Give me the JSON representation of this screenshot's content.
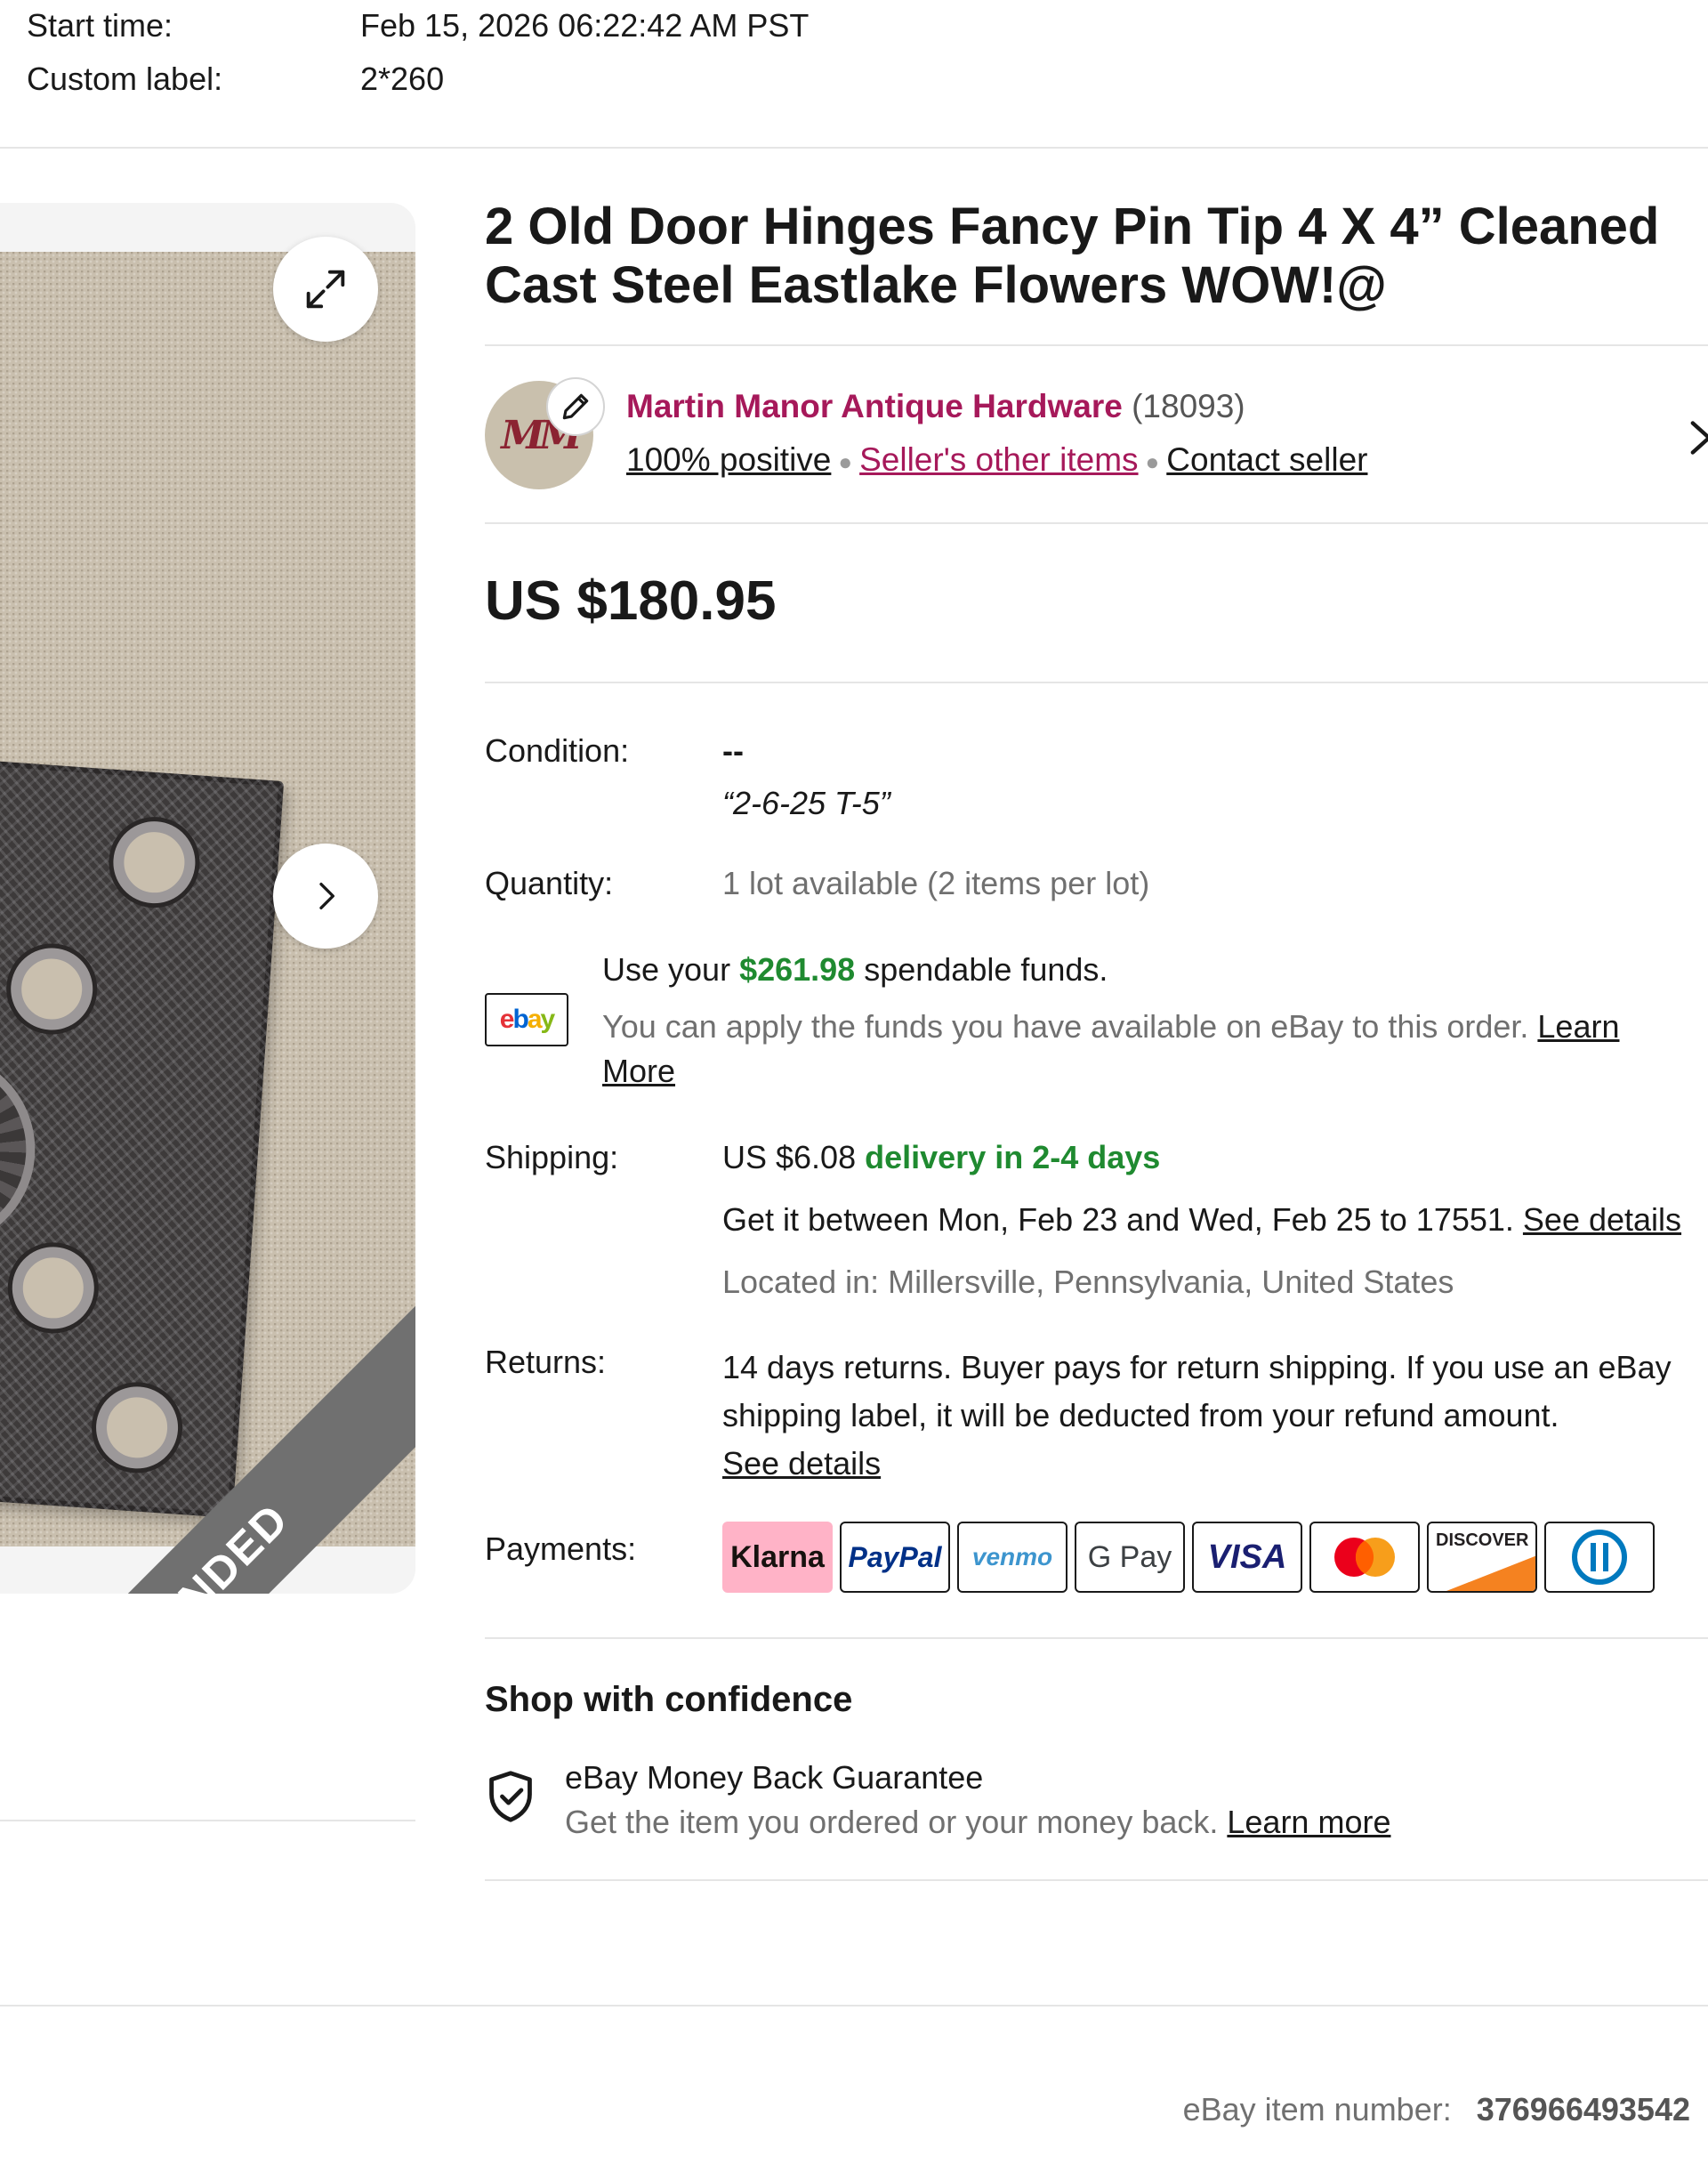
{
  "meta": {
    "start_time_label": "Start time:",
    "start_time_value": "Feb 15, 2026 06:22:42 AM PST",
    "custom_label_label": "Custom label:",
    "custom_label_value": "2*260"
  },
  "gallery": {
    "ended_label": "ENDED",
    "expand_icon": "expand-icon",
    "next_icon": "chevron-right-icon"
  },
  "item": {
    "title_line1": "2 Old Door Hinges Fancy Pin Tip 4 X 4” Cleaned",
    "title_line2": "Cast Steel Eastlake Flowers WOW!@"
  },
  "seller": {
    "name": "Martin Manor Antique Hardware",
    "feedback_count": "(18093)",
    "positive": "100% positive",
    "other_items": "Seller's other items",
    "contact": "Contact seller",
    "avatar_monogram": "MM",
    "brand_color": "#a6195a"
  },
  "price": {
    "amount": "US $180.95"
  },
  "condition": {
    "label": "Condition:",
    "value": "--",
    "note": "“2-6-25 T-5”"
  },
  "quantity": {
    "label": "Quantity:",
    "value": "1 lot available (2 items per lot)"
  },
  "funds": {
    "badge": "ebay",
    "line1_prefix": "Use your ",
    "amount": "$261.98",
    "line1_suffix": " spendable funds.",
    "line2": "You can apply the funds you have available on eBay to this order. ",
    "learn": "Learn",
    "more": "More"
  },
  "shipping": {
    "label": "Shipping:",
    "cost": "US $6.08",
    "delivery": "delivery in 2-4 days",
    "estimate": "Get it between Mon, Feb 23 and Wed, Feb 25 to 17551. ",
    "see_details": "See details",
    "location": "Located in: Millersville, Pennsylvania, United States"
  },
  "returns": {
    "label": "Returns:",
    "line1": "14 days returns. Buyer pays for return shipping. If you use an eBay",
    "line2": "shipping label, it will be deducted from your refund amount.",
    "see_details": "See details"
  },
  "payments": {
    "label": "Payments:",
    "methods": [
      "Klarna",
      "PayPal",
      "venmo",
      "G Pay",
      "VISA",
      "Mastercard",
      "DISCOVER",
      "Diners Club"
    ]
  },
  "confidence": {
    "heading": "Shop with confidence",
    "guarantee_title": "eBay Money Back Guarantee",
    "guarantee_text": "Get the item you ordered or your money back. ",
    "learn_more": "Learn more"
  },
  "footer": {
    "item_number_label": "eBay item number:",
    "item_number_value": "376966493542"
  },
  "colors": {
    "green": "#1f8a30",
    "purple": "#a6195a",
    "klarna_pink": "#ffb3c7"
  }
}
